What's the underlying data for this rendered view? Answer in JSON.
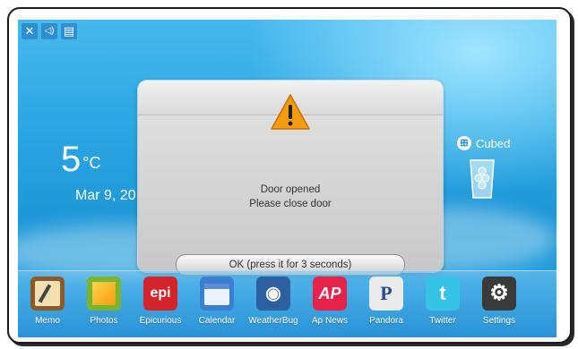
{
  "status": {
    "icons": [
      "close-icon",
      "speaker-icon",
      "network-icon"
    ],
    "glyphs": [
      "✕",
      "🔊",
      "▤"
    ]
  },
  "weather": {
    "temp": "5",
    "unit": "°C",
    "date": "Mar 9, 20"
  },
  "ice": {
    "label": "Cubed",
    "badge": "⊞"
  },
  "dialog": {
    "line1": "Door opened",
    "line2": "Please close door",
    "ok_label": "OK (press it for 3 seconds)"
  },
  "dock": {
    "apps": [
      {
        "label": "Memo",
        "color": "#8a5a2b",
        "glyph": "✎"
      },
      {
        "label": "Photos",
        "color": "#7ab52c",
        "glyph": ""
      },
      {
        "label": "Epicurious",
        "color": "#d4232b",
        "glyph": "epi"
      },
      {
        "label": "Calendar",
        "color": "#3a7fd0",
        "glyph": ""
      },
      {
        "label": "WeatherBug",
        "color": "#2e5f9e",
        "glyph": "◉"
      },
      {
        "label": "Ap News",
        "color": "#e8234b",
        "glyph": "AP"
      },
      {
        "label": "Pandora",
        "color": "#eaeaea",
        "glyph": "P"
      },
      {
        "label": "Twitter",
        "color": "#35c3e6",
        "glyph": "t"
      },
      {
        "label": "Settings",
        "color": "#3a3a3a",
        "glyph": "⚙"
      }
    ]
  },
  "colors": {
    "accent": "#1f98d8",
    "dialog_bg": "#d6d6d6",
    "warning": "#f39c12"
  }
}
